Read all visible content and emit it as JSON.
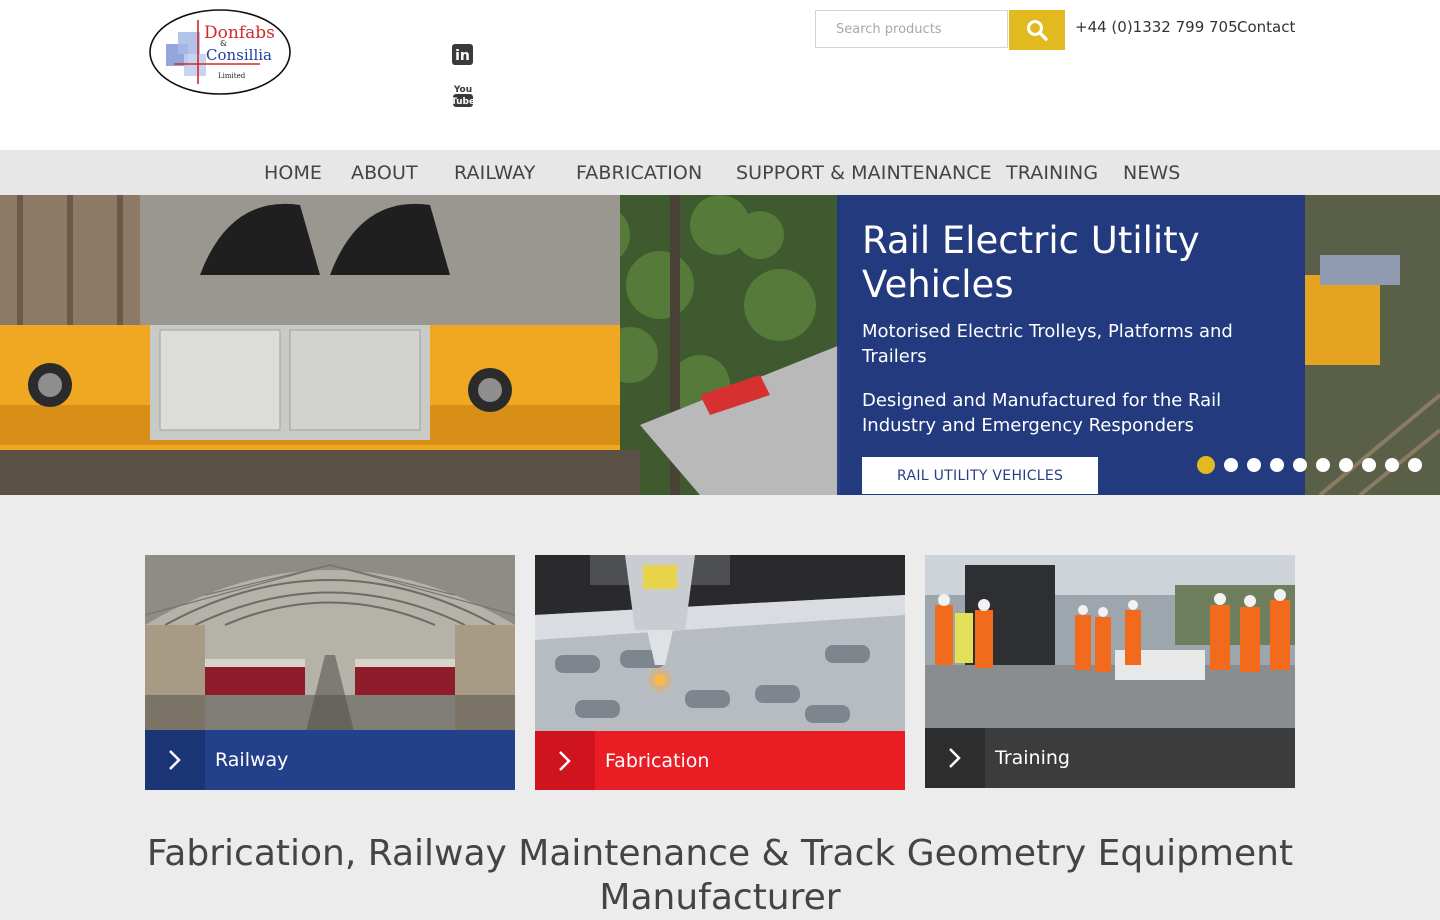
{
  "brand": {
    "logo_line1": "Donfabs",
    "logo_amp": "&",
    "logo_line2": "Consillia",
    "logo_line3": "Limited"
  },
  "social": [
    {
      "icon": "linkedin-icon",
      "text": "in"
    },
    {
      "icon": "youtube-icon",
      "text_top": "You",
      "text_bottom": "Tube"
    }
  ],
  "header": {
    "search_placeholder": "Search products",
    "phone": "+44 (0)1332 799 705",
    "contact": "Contact",
    "accent_color": "#e3b920"
  },
  "nav": {
    "items": [
      {
        "label": "HOME"
      },
      {
        "label": "ABOUT"
      },
      {
        "label": "RAILWAY"
      },
      {
        "label": "FABRICATION"
      },
      {
        "label": "SUPPORT & MAINTENANCE"
      },
      {
        "label": "TRAINING"
      },
      {
        "label": "NEWS"
      }
    ]
  },
  "hero": {
    "title": "Rail Electric Utility Vehicles",
    "subtitle1": "Motorised Electric Trolleys, Platforms and Trailers",
    "subtitle2": "Designed and Manufactured for the Rail Industry and Emergency Responders",
    "button": "RAIL UTILITY VEHICLES",
    "slide_count": 10,
    "active_slide": 1,
    "panel_color": "#1e3782"
  },
  "tiles": [
    {
      "label": "Railway",
      "color": "#22418a",
      "arrow_color": "#1a3474"
    },
    {
      "label": "Fabrication",
      "color": "#ea1c24",
      "arrow_color": "#d0141d"
    },
    {
      "label": "Training",
      "color": "#3c3c3c",
      "arrow_color": "#2d2d2d"
    }
  ],
  "main": {
    "heading_line1": "Fabrication, Railway Maintenance & Track Geometry Equipment",
    "heading_line2": "Manufacturer"
  }
}
